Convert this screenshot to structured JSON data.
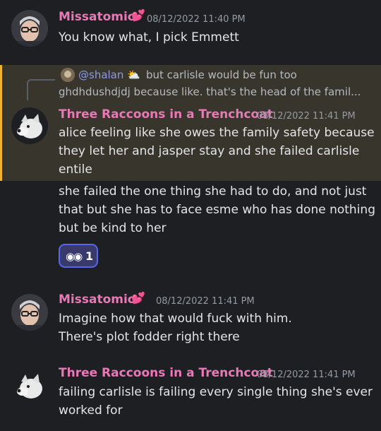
{
  "messages": [
    {
      "author": "Missatomic",
      "timestamp": "08/12/2022 11:40 PM",
      "lines": [
        "You know what, I pick Emmett"
      ]
    },
    {
      "reply": {
        "mention": "@shalan",
        "text_line1": "but carlisle would be fun too",
        "text_line2": "ghdhdushdjdj because like. that's the head of the famil..."
      },
      "author": "Three Raccoons in a Trenchcoat",
      "timestamp": "08/12/2022 11:41 PM",
      "lines": [
        "alice feeling like she owes the family safety because",
        "they let her and jasper stay and she failed carlisle",
        "entile"
      ]
    },
    {
      "lines": [
        "she failed the one thing she had to do, and not just",
        "that but she has to face esme who has done nothing",
        "but be kind to her"
      ],
      "reaction": {
        "emoji": "eyes-emoji",
        "count": "1"
      }
    },
    {
      "author": "Missatomic",
      "timestamp": "08/12/2022 11:41 PM",
      "lines": [
        "Imagine how that would fuck with him.",
        "There's plot fodder right there"
      ]
    },
    {
      "author": "Three Raccoons in a Trenchcoat",
      "timestamp": "08/12/2022 11:41 PM",
      "lines": [
        "failing carlisle is failing every single thing she's ever",
        "worked for"
      ]
    }
  ],
  "colors": {
    "background": "#1e1f22",
    "username": "#e879b6",
    "highlight": "#38352c",
    "highlight_bar": "#f0b232",
    "reaction_border": "#5865f2"
  }
}
